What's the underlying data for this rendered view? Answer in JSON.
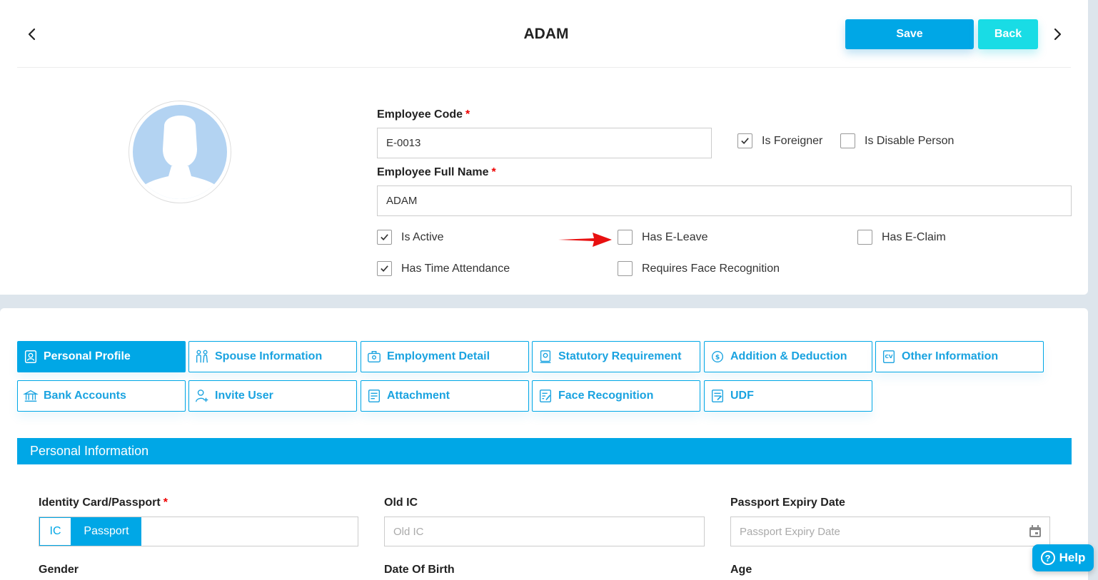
{
  "header": {
    "title": "ADAM",
    "save_label": "Save",
    "back_label": "Back"
  },
  "profile": {
    "employee_code_label": "Employee Code",
    "employee_code_value": "E-0013",
    "full_name_label": "Employee Full Name",
    "full_name_value": "ADAM",
    "required_mark": "*"
  },
  "checkboxes": {
    "is_foreigner": {
      "label": "Is Foreigner",
      "checked": true
    },
    "is_disable_person": {
      "label": "Is Disable Person",
      "checked": false
    },
    "is_active": {
      "label": "Is Active",
      "checked": true
    },
    "has_e_leave": {
      "label": "Has E-Leave",
      "checked": false
    },
    "has_e_claim": {
      "label": "Has E-Claim",
      "checked": false
    },
    "has_time_attendance": {
      "label": "Has Time Attendance",
      "checked": true
    },
    "requires_face_recognition": {
      "label": "Requires Face Recognition",
      "checked": false
    }
  },
  "tabs": [
    {
      "label": "Personal Profile",
      "icon": "id-badge-icon",
      "active": true
    },
    {
      "label": "Spouse Information",
      "icon": "couple-icon",
      "active": false
    },
    {
      "label": "Employment Detail",
      "icon": "briefcase-icon",
      "active": false
    },
    {
      "label": "Statutory Requirement",
      "icon": "certificate-icon",
      "active": false
    },
    {
      "label": "Addition & Deduction",
      "icon": "money-cycle-icon",
      "active": false
    },
    {
      "label": "Other Information",
      "icon": "cv-icon",
      "active": false
    },
    {
      "label": "Bank Accounts",
      "icon": "bank-icon",
      "active": false
    },
    {
      "label": "Invite User",
      "icon": "user-add-icon",
      "active": false
    },
    {
      "label": "Attachment",
      "icon": "document-icon",
      "active": false
    },
    {
      "label": "Face Recognition",
      "icon": "document-edit-icon",
      "active": false
    },
    {
      "label": "UDF",
      "icon": "form-icon",
      "active": false
    }
  ],
  "section": {
    "title": "Personal Information"
  },
  "personal": {
    "identity_label": "Identity Card/Passport",
    "ic_option": "IC",
    "passport_option": "Passport",
    "selected_option": "Passport",
    "old_ic_label": "Old IC",
    "old_ic_placeholder": "Old IC",
    "passport_expiry_label": "Passport Expiry Date",
    "passport_expiry_placeholder": "Passport Expiry Date",
    "gender_label": "Gender",
    "dob_label": "Date Of Birth",
    "age_label": "Age"
  },
  "help": {
    "label": "Help",
    "icon_glyph": "?"
  },
  "colors": {
    "primary": "#00a7e6",
    "back_button": "#19dce5",
    "required": "#e00000",
    "annotation_arrow": "#e81010"
  }
}
